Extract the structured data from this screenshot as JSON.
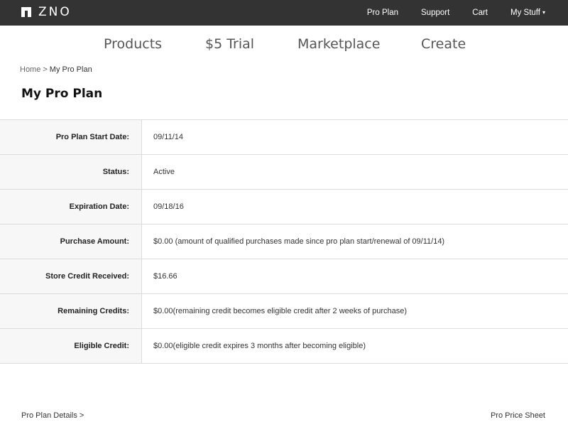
{
  "header": {
    "logo_text": "ZNO",
    "nav": [
      {
        "label": "Pro Plan"
      },
      {
        "label": "Support"
      },
      {
        "label": "Cart"
      },
      {
        "label": "My Stuff"
      }
    ],
    "my_stuff_caret": "▾"
  },
  "main_nav": [
    {
      "label": "Products"
    },
    {
      "label": "$5 Trial"
    },
    {
      "label": "Marketplace"
    },
    {
      "label": "Create"
    }
  ],
  "breadcrumb": {
    "home": "Home",
    "separator": ">",
    "current": "My Pro Plan"
  },
  "page_title": "My Pro Plan",
  "plan_rows": [
    {
      "label": "Pro Plan Start Date:",
      "value": "09/11/14"
    },
    {
      "label": "Status:",
      "value": "Active"
    },
    {
      "label": "Expiration Date:",
      "value": "09/18/16"
    },
    {
      "label": "Purchase Amount:",
      "value": "$0.00 (amount of qualified purchases made since pro plan start/renewal of 09/11/14)"
    },
    {
      "label": "Store Credit Received:",
      "value": "$16.66"
    },
    {
      "label": "Remaining Credits:",
      "value": "$0.00(remaining credit becomes eligible credit after 2 weeks of purchase)"
    },
    {
      "label": "Eligible Credit:",
      "value": "$0.00(eligible credit expires 3 months after becoming eligible)"
    }
  ],
  "footer_links": {
    "details": "Pro Plan Details >",
    "price_sheet": "Pro Price Sheet"
  },
  "colors": {
    "topbar_bg": "#333333",
    "label_bg": "#f7f7f7",
    "border": "#dcdcdc"
  },
  "icons": {
    "logo_mark": "zno-logo-icon"
  }
}
